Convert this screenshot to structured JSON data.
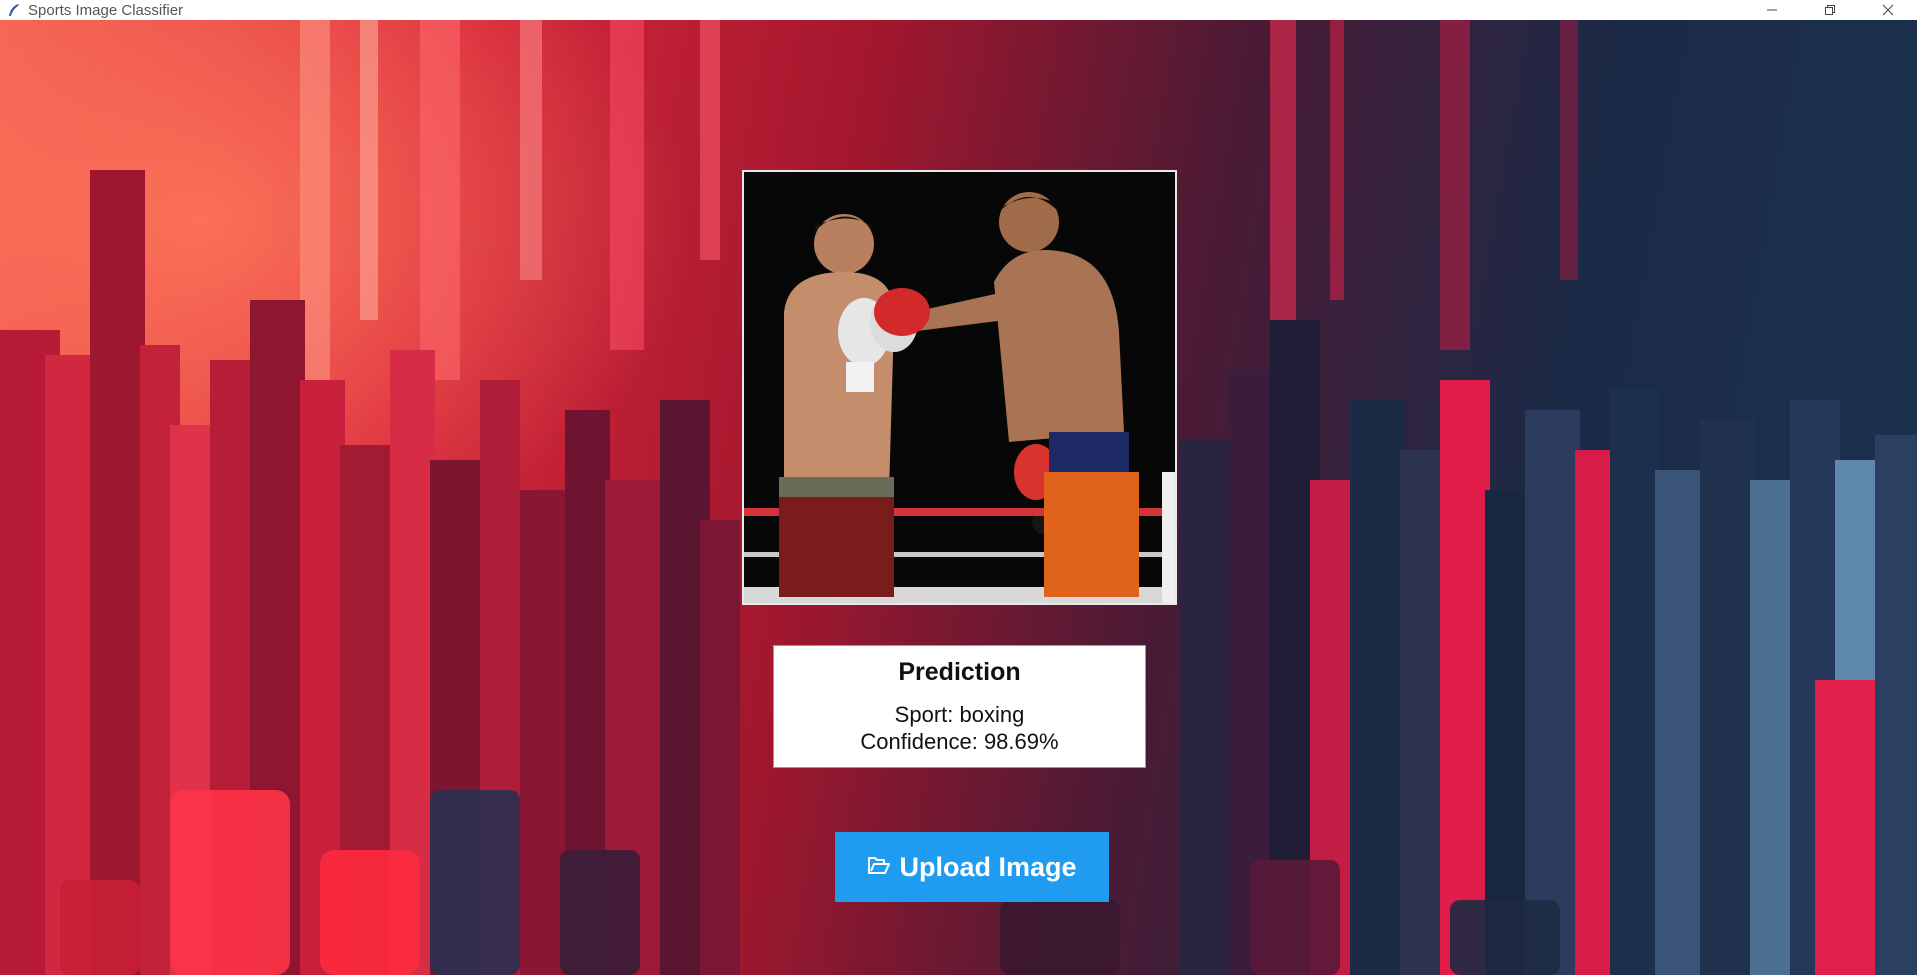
{
  "window": {
    "title": "Sports Image Classifier",
    "controls": [
      "minimize-icon",
      "restore-icon",
      "close-icon"
    ]
  },
  "image": {
    "description_icon": "boxing-photo"
  },
  "prediction": {
    "heading": "Prediction",
    "sport_line": "Sport: boxing",
    "confidence_line": "Confidence: 98.69%"
  },
  "upload_button": {
    "label": "Upload Image",
    "icon": "folder-open-icon",
    "color": "#1f9bef"
  }
}
